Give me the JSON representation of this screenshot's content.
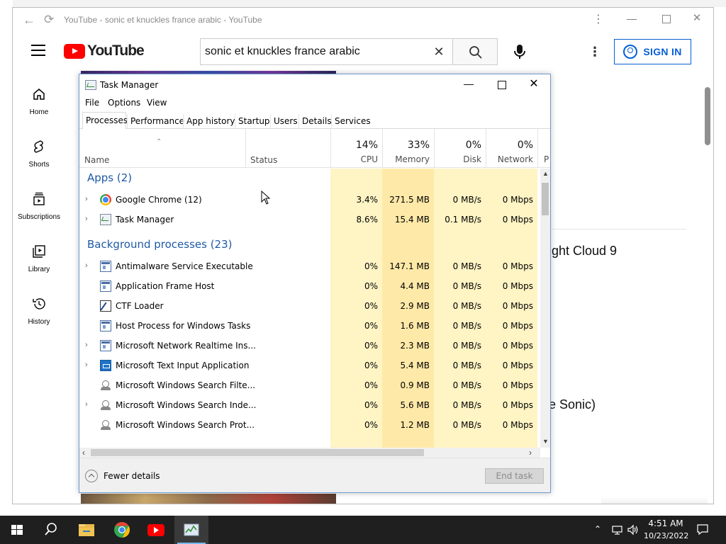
{
  "browser": {
    "title": "YouTube - sonic et knuckles france arabic - YouTube"
  },
  "youtube": {
    "logo_text": "YouTube",
    "search": {
      "value": "sonic et knuckles france arabic"
    },
    "signin_label": "SIGN IN",
    "sidebar": [
      {
        "label": "Home",
        "icon": "home-icon"
      },
      {
        "label": "Shorts",
        "icon": "shorts-icon"
      },
      {
        "label": "Subscriptions",
        "icon": "subscriptions-icon"
      },
      {
        "label": "Library",
        "icon": "library-icon"
      },
      {
        "label": "History",
        "icon": "history-icon"
      }
    ],
    "bg_text_1": "ight Cloud 9",
    "bg_text_2": "e Sonic)"
  },
  "task_manager": {
    "title": "Task Manager",
    "menu": [
      "File",
      "Options",
      "View"
    ],
    "tabs": [
      "Processes",
      "Performance",
      "App history",
      "Startup",
      "Users",
      "Details",
      "Services"
    ],
    "active_tab": "Processes",
    "columns": {
      "name": "Name",
      "status": "Status",
      "cpu": {
        "pct": "14%",
        "label": "CPU"
      },
      "memory": {
        "pct": "33%",
        "label": "Memory"
      },
      "disk": {
        "pct": "0%",
        "label": "Disk"
      },
      "network": {
        "pct": "0%",
        "label": "Network"
      },
      "power_partial": "P"
    },
    "groups": {
      "apps": "Apps (2)",
      "background": "Background processes (23)"
    },
    "apps": [
      {
        "name": "Google Chrome (12)",
        "icon": "chrome-icon",
        "expand": true,
        "cpu": "3.4%",
        "memory": "271.5 MB",
        "disk": "0 MB/s",
        "network": "0 Mbps"
      },
      {
        "name": "Task Manager",
        "icon": "task-manager-icon",
        "expand": true,
        "cpu": "8.6%",
        "memory": "15.4 MB",
        "disk": "0.1 MB/s",
        "network": "0 Mbps"
      }
    ],
    "background": [
      {
        "name": "Antimalware Service Executable",
        "icon": "app-icon",
        "expand": true,
        "cpu": "0%",
        "memory": "147.1 MB",
        "disk": "0 MB/s",
        "network": "0 Mbps"
      },
      {
        "name": "Application Frame Host",
        "icon": "app-icon",
        "expand": false,
        "cpu": "0%",
        "memory": "4.4 MB",
        "disk": "0 MB/s",
        "network": "0 Mbps"
      },
      {
        "name": "CTF Loader",
        "icon": "ctf-icon",
        "expand": false,
        "cpu": "0%",
        "memory": "2.9 MB",
        "disk": "0 MB/s",
        "network": "0 Mbps"
      },
      {
        "name": "Host Process for Windows Tasks",
        "icon": "app-icon",
        "expand": false,
        "cpu": "0%",
        "memory": "1.6 MB",
        "disk": "0 MB/s",
        "network": "0 Mbps"
      },
      {
        "name": "Microsoft Network Realtime Ins...",
        "icon": "app-icon",
        "expand": true,
        "cpu": "0%",
        "memory": "2.3 MB",
        "disk": "0 MB/s",
        "network": "0 Mbps"
      },
      {
        "name": "Microsoft Text Input Application",
        "icon": "text-input-icon",
        "expand": true,
        "cpu": "0%",
        "memory": "5.4 MB",
        "disk": "0 MB/s",
        "network": "0 Mbps"
      },
      {
        "name": "Microsoft Windows Search Filte...",
        "icon": "search-process-icon",
        "expand": false,
        "cpu": "0%",
        "memory": "0.9 MB",
        "disk": "0 MB/s",
        "network": "0 Mbps"
      },
      {
        "name": "Microsoft Windows Search Inde...",
        "icon": "search-process-icon",
        "expand": true,
        "cpu": "0%",
        "memory": "5.6 MB",
        "disk": "0 MB/s",
        "network": "0 Mbps"
      },
      {
        "name": "Microsoft Windows Search Prot...",
        "icon": "search-process-icon",
        "expand": false,
        "cpu": "0%",
        "memory": "1.2 MB",
        "disk": "0 MB/s",
        "network": "0 Mbps"
      }
    ],
    "footer": {
      "fewer_details": "Fewer details",
      "end_task": "End task"
    },
    "colors": {
      "cpu_bg": "#fff4c4",
      "mem_bg": "#ffe9a8",
      "disk_bg": "#fff4c4",
      "net_bg": "#fff4c4",
      "group": "#1f5aa6"
    }
  },
  "taskbar": {
    "apps": [
      "file-explorer-icon",
      "chrome-icon",
      "youtube-icon",
      "task-manager-icon"
    ],
    "time": "4:51 AM",
    "date": "10/23/2022"
  }
}
